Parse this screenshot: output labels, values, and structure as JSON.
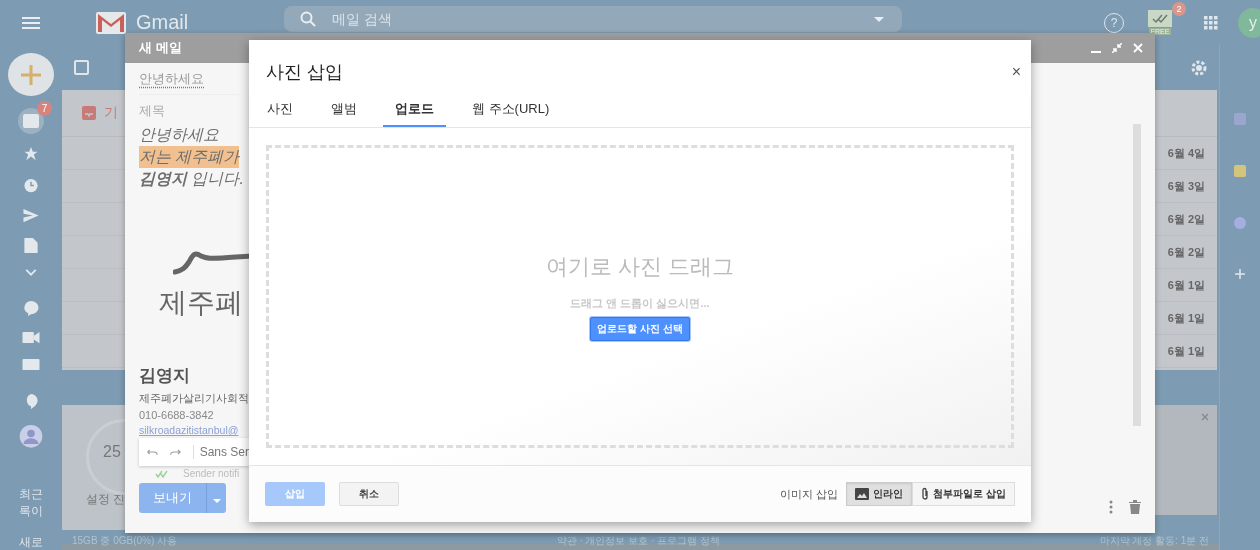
{
  "app": {
    "logo_text": "Gmail",
    "search_placeholder": "메일 검색",
    "addon_badge": "2",
    "addon_label": "FREE",
    "help_label": "?",
    "avatar_letter": "y"
  },
  "rail": {
    "inbox_badge": "7",
    "chat_texts": [
      "최근",
      "록이",
      "새로"
    ]
  },
  "mail_list": {
    "select_all_checked": false,
    "tab": "기",
    "dates": [
      "6월 4일",
      "6월 3일",
      "6월 2일",
      "6월 2일",
      "6월 1일",
      "6월 1일",
      "6월 1일"
    ]
  },
  "setup_card": {
    "percent": "25",
    "label": "설정 진"
  },
  "storage": "15GB 중 0GB(0%) 사용",
  "footer_links": "약관 · 개인정보 보호 · 프로그램 정책",
  "activity": "마지막 계정 활동: 1분 전",
  "compose": {
    "title": "새 메일",
    "to": "안녕하세요",
    "subject_placeholder": "제목",
    "body_lines": [
      {
        "text": "안녕하세요",
        "highlighted": false
      },
      {
        "text": "저는 제주폐가",
        "highlighted": true
      },
      {
        "text": "**김영지** 입니다.",
        "highlighted": false
      }
    ],
    "signature_logo_text": "제주폐",
    "signature": {
      "name": "김영지",
      "org": "제주폐가살리기사회적",
      "phone": "010-6688-3842",
      "email": "silkroadazitistanbul@"
    },
    "font_name": "Sans Ser",
    "sender_note": "Sender notifi",
    "send_label": "보내기"
  },
  "dialog": {
    "title": "사진 삽입",
    "close": "×",
    "tabs": [
      {
        "label": "사진",
        "selected": false
      },
      {
        "label": "앨범",
        "selected": false
      },
      {
        "label": "업로드",
        "selected": true
      },
      {
        "label": "웹 주소(URL)",
        "selected": false
      }
    ],
    "drop_title": "여기로 사진 드래그",
    "drop_hint": "드래그 앤 드롭이 싫으시면...",
    "choose_label": "업로드할 사진 선택",
    "insert": {
      "label": "삽입",
      "disabled": true
    },
    "cancel_label": "취소",
    "insert_mode_label": "이미지 삽입",
    "insert_modes": [
      {
        "kind": "inline",
        "label": "인라인",
        "selected": true
      },
      {
        "kind": "attachment",
        "label": "첨부파일로 삽입",
        "selected": false
      }
    ]
  }
}
